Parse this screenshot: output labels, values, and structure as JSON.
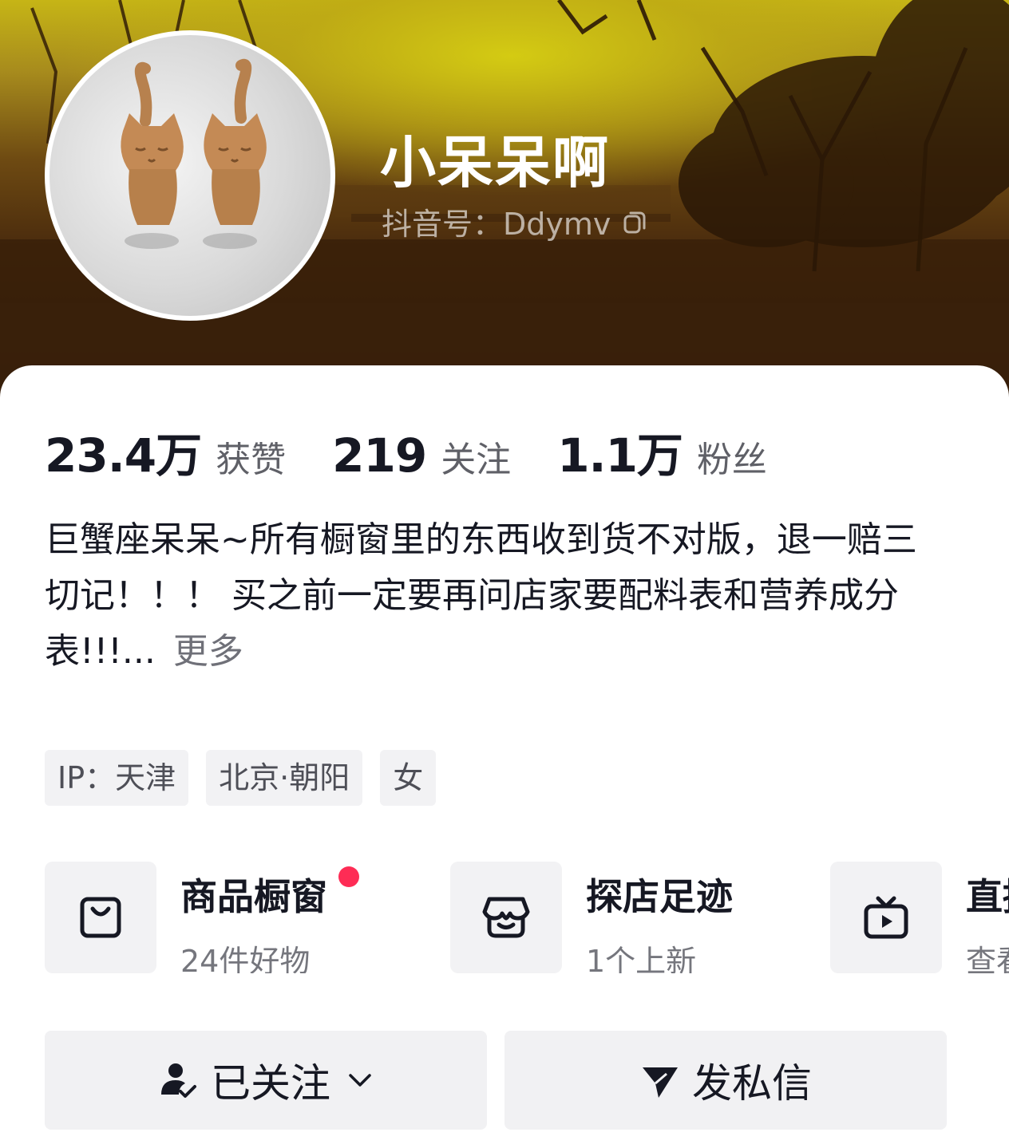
{
  "profile": {
    "nickname": "小呆呆啊",
    "douyin_id": "抖音号：Ddymv",
    "avatar_icon": "clay-cat-figurines-avatar"
  },
  "stats": [
    {
      "value": "23.4万",
      "label": "获赞"
    },
    {
      "value": "219",
      "label": "关注"
    },
    {
      "value": "1.1万",
      "label": "粉丝"
    }
  ],
  "bio": {
    "line1": "巨蟹座呆呆~所有橱窗里的东西收到货不对版，退一赔三",
    "line2": "切记！！！ 买之前一定要再问店家要配料表和营养成分表!!!...",
    "more": "更多"
  },
  "tags": [
    "IP：天津",
    "北京·朝阳",
    "女"
  ],
  "features": [
    {
      "title": "商品橱窗",
      "subtitle": "24件好物",
      "icon": "shopping-bag-icon",
      "has_dot": true
    },
    {
      "title": "探店足迹",
      "subtitle": "1个上新",
      "icon": "storefront-icon",
      "has_dot": false
    },
    {
      "title": "直播",
      "subtitle": "查看",
      "icon": "tv-play-icon",
      "has_dot": false
    }
  ],
  "actions": {
    "follow_label": "已关注",
    "message_label": "发私信"
  },
  "colors": {
    "accent_dot": "#fe2c55",
    "primary_text": "#161823",
    "secondary_text": "#5f6067"
  }
}
